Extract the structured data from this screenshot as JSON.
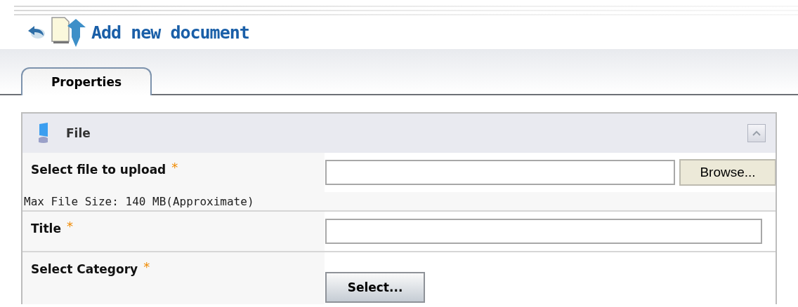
{
  "page": {
    "title": "Add new document"
  },
  "tabs": [
    {
      "label": "Properties",
      "selected": true
    }
  ],
  "panel": {
    "title": "File",
    "expanded": true
  },
  "fields": [
    {
      "kind": "file",
      "label": "Select file to upload",
      "mark": "*",
      "button": "Browse...",
      "note": "Max File Size: 140 MB(Approximate)"
    },
    {
      "kind": "text",
      "label": "Title",
      "mark": "*"
    },
    {
      "kind": "category",
      "label": "Select Category",
      "mark": "*",
      "button": "Select..."
    }
  ]
}
